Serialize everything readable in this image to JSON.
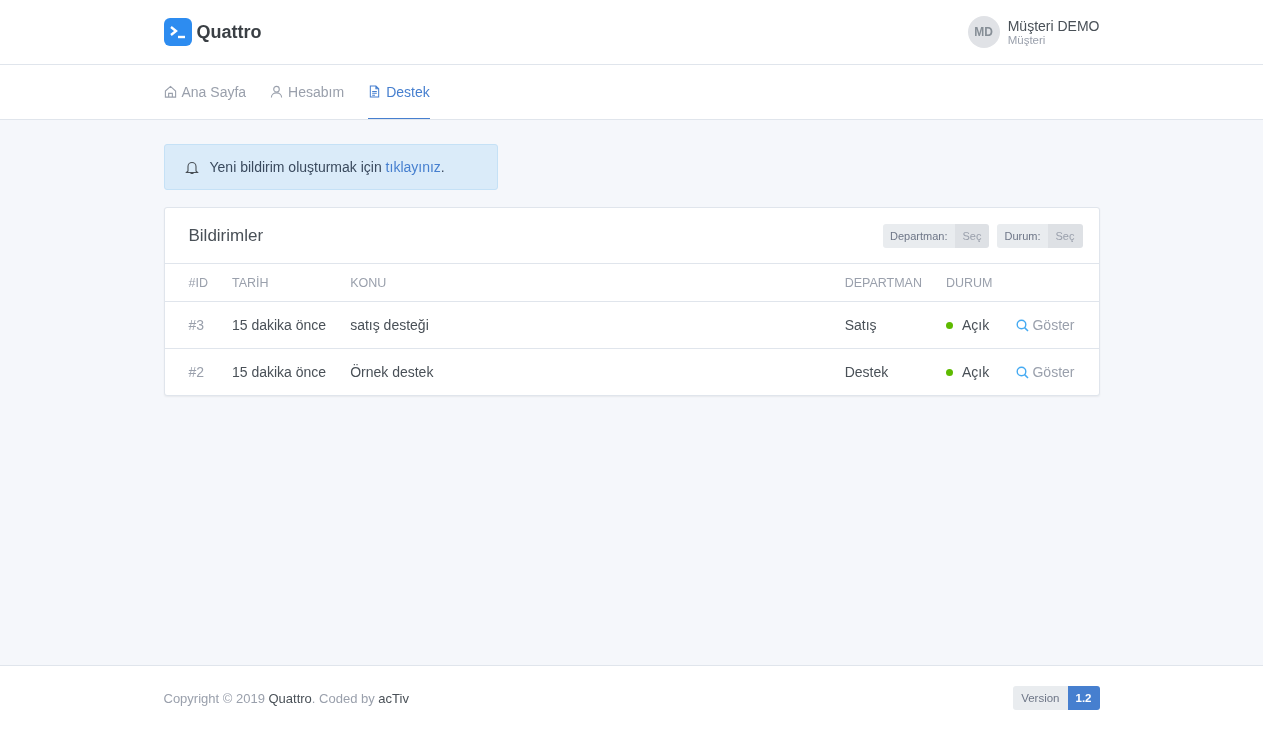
{
  "brand": {
    "name": "Quattro"
  },
  "user": {
    "initials": "MD",
    "name": "Müşteri DEMO",
    "role": "Müşteri"
  },
  "nav": [
    {
      "label": "Ana Sayfa",
      "kind": "home",
      "selected": false
    },
    {
      "label": "Hesabım",
      "kind": "user",
      "selected": false
    },
    {
      "label": "Destek",
      "kind": "document",
      "selected": true
    }
  ],
  "alert": {
    "text": "Yeni bildirim oluşturmak için ",
    "link": "tıklayınız",
    "end": "."
  },
  "card": {
    "title": "Bildirimler",
    "filters": [
      {
        "label": "Departman:",
        "value": "Seç"
      },
      {
        "label": "Durum:",
        "value": "Seç"
      }
    ],
    "columns": [
      "#ID",
      "TARİH",
      "KONU",
      "DEPARTMAN",
      "DURUM"
    ],
    "rows": [
      {
        "id": "#3",
        "date": "15 dakika önce",
        "subject": "satış desteği",
        "department": "Satış",
        "status": "Açık",
        "color": "#5eba00",
        "action": "Göster"
      },
      {
        "id": "#2",
        "date": "15 dakika önce",
        "subject": "Örnek destek",
        "department": "Destek",
        "status": "Açık",
        "color": "#5eba00",
        "action": "Göster"
      }
    ]
  },
  "footer": {
    "prefix": "Copyright © 2019 ",
    "brand": "Quattro",
    "middle": ". Coded by ",
    "author": "acTiv",
    "version_label": "Version",
    "version": "1.2"
  }
}
